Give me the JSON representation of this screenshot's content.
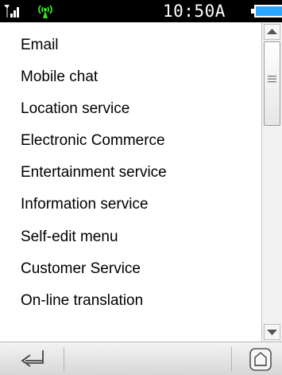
{
  "status_bar": {
    "time": "10:50A",
    "signal_icon": "signal-strength-icon",
    "antenna_icon": "antenna-icon",
    "battery_icon": "battery-icon",
    "antenna_color": "#3ddc2a",
    "battery_color": "#2aa7ff"
  },
  "menu": {
    "items": [
      {
        "label": "Email"
      },
      {
        "label": "Mobile chat"
      },
      {
        "label": "Location service"
      },
      {
        "label": "Electronic Commerce"
      },
      {
        "label": "Entertainment service"
      },
      {
        "label": "Information service"
      },
      {
        "label": "Self-edit menu"
      },
      {
        "label": "Customer Service"
      },
      {
        "label": "On-line translation"
      }
    ]
  },
  "scrollbar": {
    "up_icon": "scroll-up-arrow-icon",
    "down_icon": "scroll-down-arrow-icon"
  },
  "softkeys": {
    "back_icon": "back-return-icon",
    "home_icon": "home-icon"
  }
}
